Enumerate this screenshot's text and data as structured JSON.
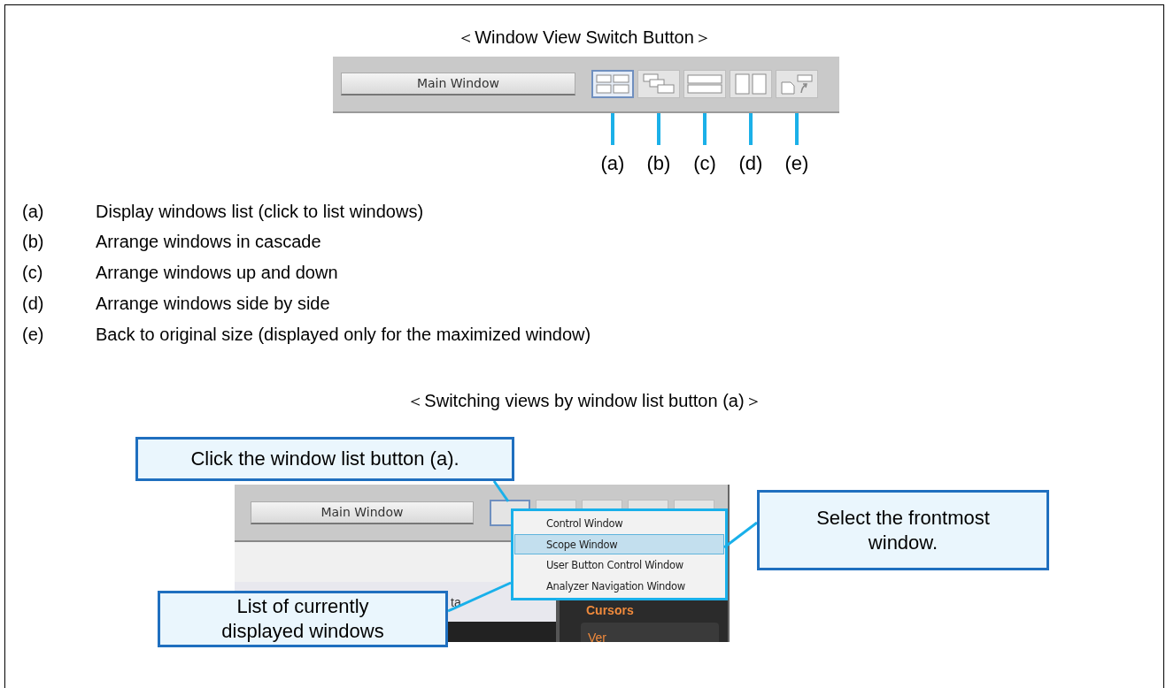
{
  "title_top": "＜Window View Switch Button＞",
  "toolbar": {
    "main_button": "Main Window",
    "view_buttons": [
      {
        "kind": "list",
        "label": "(a)",
        "selected": true
      },
      {
        "kind": "cascade",
        "label": "(b)",
        "selected": false
      },
      {
        "kind": "updown",
        "label": "(c)",
        "selected": false
      },
      {
        "kind": "sidebyside",
        "label": "(d)",
        "selected": false
      },
      {
        "kind": "restore",
        "label": "(e)",
        "selected": false
      }
    ]
  },
  "legend": [
    {
      "key": "(a)",
      "text": "Display windows list (click to list windows)"
    },
    {
      "key": "(b)",
      "text": "Arrange windows in cascade"
    },
    {
      "key": "(c)",
      "text": "Arrange windows up and down"
    },
    {
      "key": "(d)",
      "text": "Arrange windows side by side"
    },
    {
      "key": "(e)",
      "text": "Back to original size (displayed only for the maximized window)"
    }
  ],
  "title_bottom": "＜Switching views by window list button (a)＞",
  "screenshot": {
    "main_button": "Main Window",
    "panel_text": "ta",
    "cursors_label": "Cursors",
    "ver_label": "Ver",
    "menu": [
      {
        "label": "Control Window",
        "selected": false
      },
      {
        "label": "Scope Window",
        "selected": true
      },
      {
        "label": "User Button Control Window",
        "selected": false
      },
      {
        "label": "Analyzer Navigation Window",
        "selected": false
      }
    ]
  },
  "callouts": [
    {
      "kind": "click",
      "text": "Click the window list button (a)."
    },
    {
      "kind": "select",
      "text": "Select the frontmost window."
    },
    {
      "kind": "list",
      "text": "List of currently displayed windows"
    }
  ]
}
